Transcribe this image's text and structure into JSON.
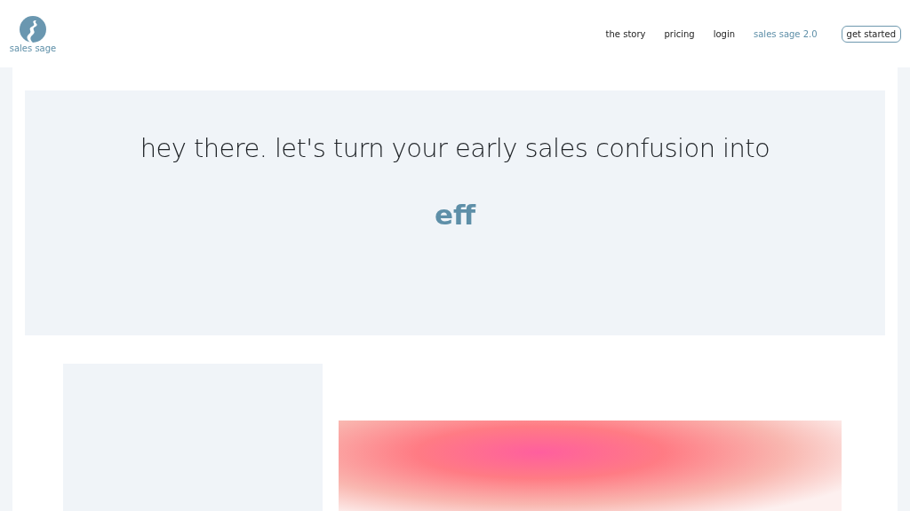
{
  "logo": {
    "text": "sales sage"
  },
  "nav": [
    {
      "label": "the story",
      "kind": "link"
    },
    {
      "label": "pricing",
      "kind": "link"
    },
    {
      "label": "login",
      "kind": "link"
    },
    {
      "label": "sales sage 2.0",
      "kind": "accent"
    },
    {
      "label": "get started",
      "kind": "button"
    }
  ],
  "hero": {
    "headline": "hey there. let's turn your early sales confusion into",
    "typed_word": "eff"
  }
}
